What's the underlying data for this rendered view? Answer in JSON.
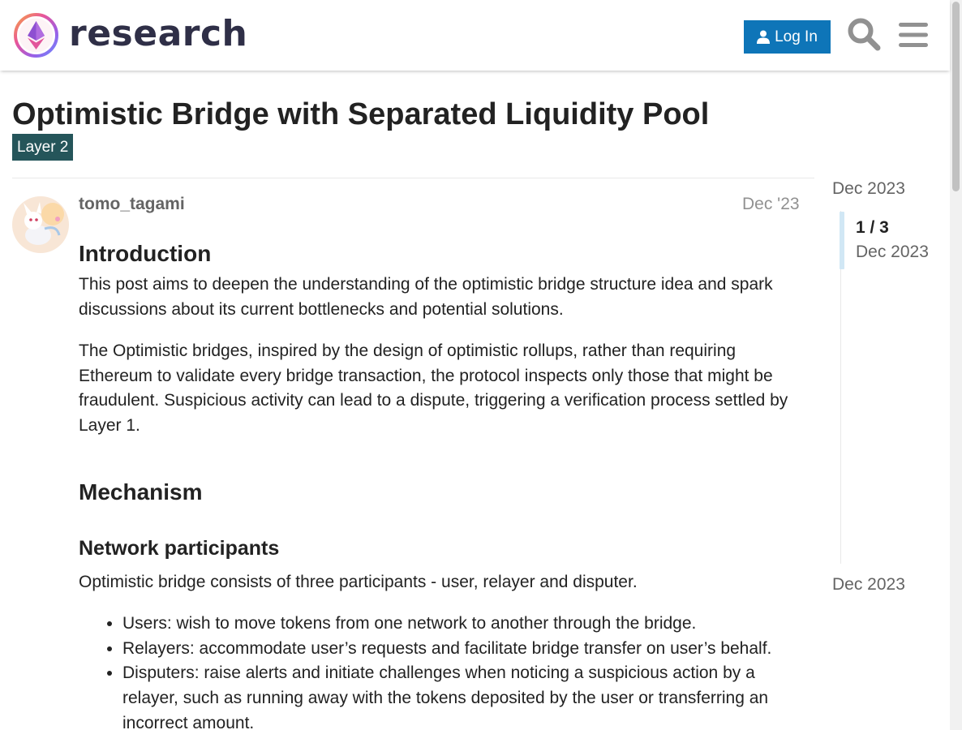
{
  "header": {
    "site_name": "research",
    "login_label": "Log In",
    "icons": {
      "logo": "ethereum-research-logo",
      "user": "user-icon",
      "search": "search-icon",
      "menu": "hamburger-menu-icon"
    },
    "brand_color": "#0e75b8"
  },
  "topic": {
    "title": "Optimistic Bridge with Separated Liquidity Pool",
    "category": "Layer 2",
    "category_color": "#25555a"
  },
  "post": {
    "username": "tomo_tagami",
    "date": "Dec '23",
    "h_intro": "Introduction",
    "p1": "This post aims to deepen the understanding of the optimistic bridge structure idea and spark discussions about its current bottlenecks and potential solutions.",
    "p2": "The Optimistic bridges, inspired by the design of optimistic rollups, rather than requiring Ethereum to validate every bridge transaction, the protocol inspects only those that might be fraudulent. Suspicious activity can lead to a dispute, triggering a verification process settled by Layer 1.",
    "h_mechanism": "Mechanism",
    "h_participants": "Network participants",
    "p3": "Optimistic bridge consists of three participants - user, relayer and disputer.",
    "list": [
      "Users: wish to move tokens from one network to another through the bridge.",
      "Relayers: accommodate user’s requests and facilitate bridge transfer on user’s behalf.",
      "Disputers: raise alerts and initiate challenges when noticing a suspicious action by a relayer, such as running away with the tokens deposited by the user or transferring an incorrect amount."
    ]
  },
  "timeline": {
    "start": "Dec 2023",
    "position": "1 / 3",
    "current_date": "Dec 2023",
    "end": "Dec 2023"
  }
}
